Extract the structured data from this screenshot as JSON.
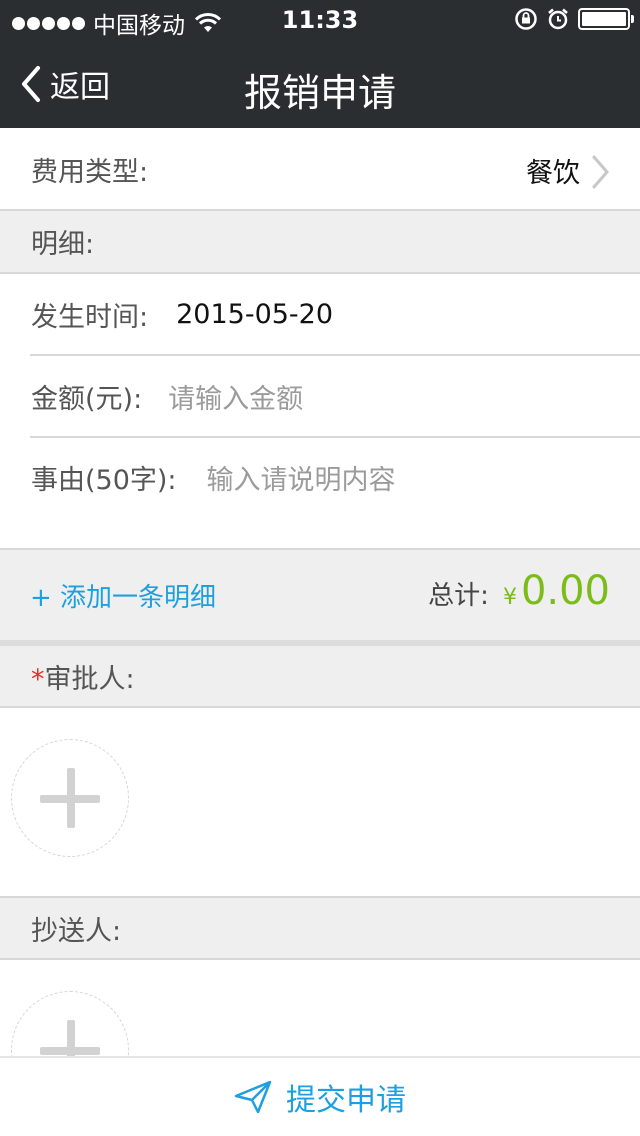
{
  "status_bar": {
    "carrier": "中国移动",
    "time": "11:33"
  },
  "nav": {
    "back_label": "返回",
    "title": "报销申请"
  },
  "expense_type": {
    "label": "费用类型:",
    "value": "餐饮"
  },
  "detail_section": {
    "label": "明细:"
  },
  "detail": {
    "date_label": "发生时间:",
    "date_value": "2015-05-20",
    "amount_label": "金额(元):",
    "amount_placeholder": "请输入金额",
    "reason_label": "事由(50字):",
    "reason_placeholder": "输入请说明内容"
  },
  "summary": {
    "add_detail": "+ 添加一条明细",
    "total_label": "总计:",
    "currency": "¥",
    "total_value": "0.00"
  },
  "approver": {
    "required_mark": "*",
    "label": "审批人:"
  },
  "cc": {
    "label": "抄送人:"
  },
  "submit": {
    "label": "提交申请"
  },
  "colors": {
    "nav_bg": "#2b2e30",
    "accent_blue": "#1ea0e0",
    "total_green": "#7cbc18",
    "required_red": "#e0302a"
  },
  "icons": [
    "wifi-icon",
    "rotation-lock-icon",
    "alarm-icon",
    "battery-icon",
    "back-chevron-icon",
    "chevron-right-icon",
    "add-icon",
    "send-icon"
  ]
}
